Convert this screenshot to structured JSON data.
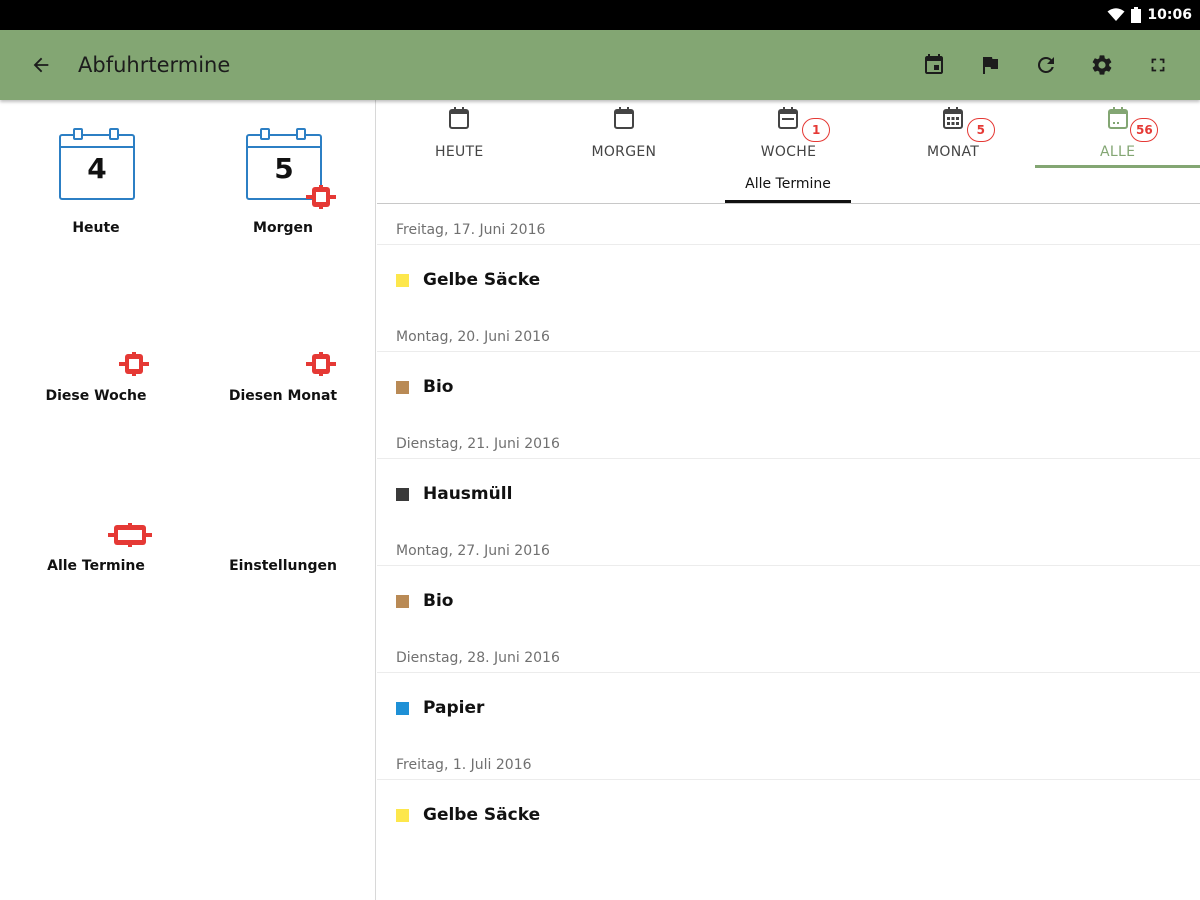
{
  "status_bar": {
    "time": "10:06",
    "wifi_icon": "wifi-icon",
    "battery_icon": "battery-icon"
  },
  "app_bar": {
    "title": "Abfuhrtermine",
    "back_icon": "arrow-back-icon",
    "actions": [
      "calendar-event-icon",
      "flag-icon",
      "refresh-icon",
      "settings-icon",
      "fullscreen-icon"
    ],
    "color": "#83a673"
  },
  "left_panel": {
    "today": {
      "label": "Heute",
      "day": "4"
    },
    "tomorrow": {
      "label": "Morgen",
      "day": "5"
    },
    "week": {
      "label": "Diese Woche"
    },
    "month": {
      "label": "Diesen Monat"
    },
    "all": {
      "label": "Alle Termine"
    },
    "settings": {
      "label": "Einstellungen"
    }
  },
  "tabs": [
    {
      "label": "HEUTE",
      "count": ""
    },
    {
      "label": "MORGEN",
      "count": ""
    },
    {
      "label": "WOCHE",
      "count": "1"
    },
    {
      "label": "MONAT",
      "count": "5"
    },
    {
      "label": "ALLE",
      "count": "56",
      "active": true
    }
  ],
  "subtab": {
    "label": "Alle Termine"
  },
  "events": [
    {
      "date": "Freitag, 17. Juni 2016",
      "type": "Gelbe Säcke",
      "color": "#fde74c"
    },
    {
      "date": "Montag, 20. Juni 2016",
      "type": "Bio",
      "color": "#b98a55"
    },
    {
      "date": "Dienstag, 21. Juni 2016",
      "type": "Hausmüll",
      "color": "#3a3a3a"
    },
    {
      "date": "Montag, 27. Juni 2016",
      "type": "Bio",
      "color": "#b98a55"
    },
    {
      "date": "Dienstag, 28. Juni 2016",
      "type": "Papier",
      "color": "#1e90d6"
    },
    {
      "date": "Freitag, 1. Juli 2016",
      "type": "Gelbe Säcke",
      "color": "#fde74c"
    }
  ]
}
